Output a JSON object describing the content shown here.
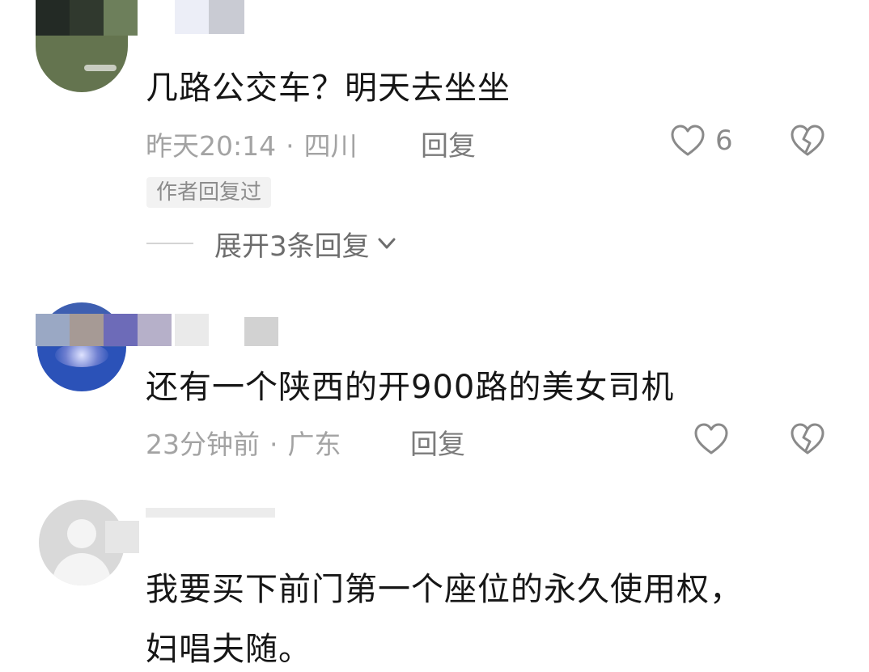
{
  "comments": [
    {
      "text": "几路公交车？明天去坐坐",
      "time": "昨天20:14",
      "location": "四川",
      "separator": "·",
      "reply_label": "回复",
      "like_count": "6",
      "author_tag": "作者回复过",
      "expand_label": "展开3条回复"
    },
    {
      "text": "还有一个陕西的开900路的美女司机",
      "time": "23分钟前",
      "location": "广东",
      "separator": "·",
      "reply_label": "回复"
    },
    {
      "text_line1": "我要买下前门第一个座位的永久使用权，",
      "text_line2": "妇唱夫随。"
    }
  ],
  "icons": {
    "like": "heart-outline-icon",
    "dislike": "broken-heart-icon",
    "expand": "chevron-down-icon"
  },
  "colors": {
    "text": "#161616",
    "meta": "#a3a3a3",
    "reply": "#7b7b7b",
    "icon": "#8a8a8a"
  }
}
